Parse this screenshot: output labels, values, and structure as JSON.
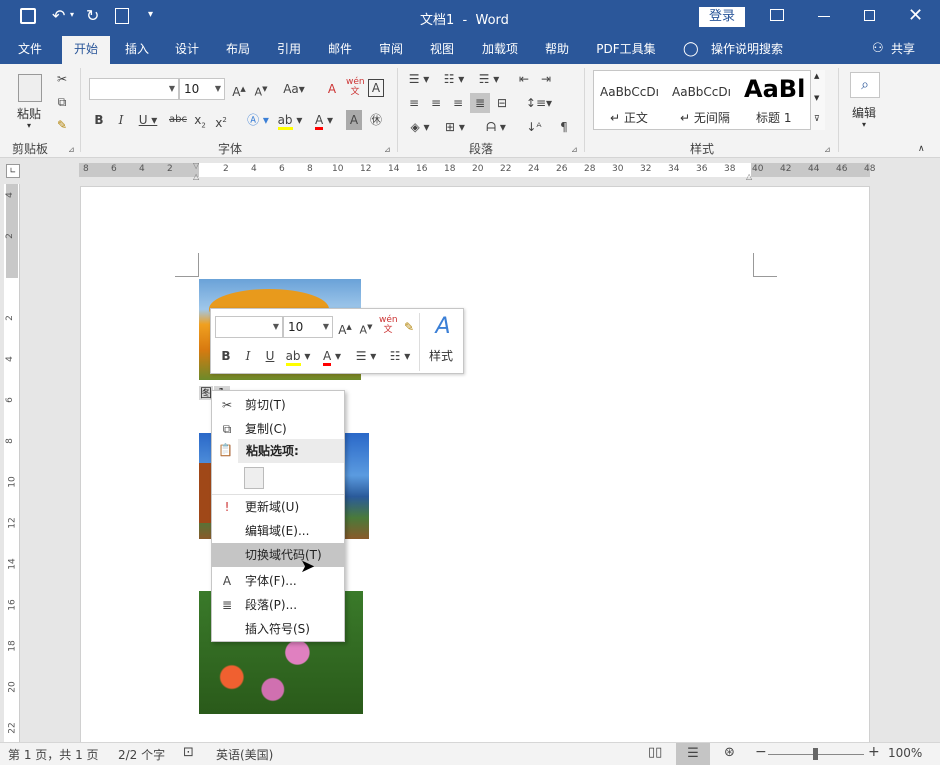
{
  "titlebar": {
    "doc_title": "文档1  -  Word",
    "login_label": "登录",
    "quick_access": [
      "save-icon",
      "undo-icon",
      "redo-icon",
      "touch-mode-icon",
      "customize-icon"
    ],
    "window_controls": [
      "ribbon-display-icon",
      "minimize-icon",
      "maximize-icon",
      "close-icon"
    ]
  },
  "tabs": [
    {
      "label": "文件"
    },
    {
      "label": "开始"
    },
    {
      "label": "插入"
    },
    {
      "label": "设计"
    },
    {
      "label": "布局"
    },
    {
      "label": "引用"
    },
    {
      "label": "邮件"
    },
    {
      "label": "审阅"
    },
    {
      "label": "视图"
    },
    {
      "label": "加载项"
    },
    {
      "label": "帮助"
    },
    {
      "label": "PDF工具集"
    }
  ],
  "tell_me": "操作说明搜索",
  "share": "共享",
  "ribbon": {
    "clipboard": {
      "label": "剪贴板",
      "paste": "粘贴"
    },
    "font": {
      "label": "字体",
      "font_name": "",
      "font_size": "10"
    },
    "paragraph": {
      "label": "段落"
    },
    "styles": {
      "label": "样式",
      "items": [
        {
          "preview": "AaBbCcDı",
          "name": "↵ 正文"
        },
        {
          "preview": "AaBbCcDı",
          "name": "↵ 无间隔"
        },
        {
          "preview": "AaBl",
          "name": "标题 1"
        }
      ]
    },
    "editing": {
      "label": "编辑"
    }
  },
  "ruler_h": [
    "8",
    "6",
    "4",
    "2",
    "",
    "2",
    "4",
    "6",
    "8",
    "10",
    "12",
    "14",
    "16",
    "18",
    "20",
    "22",
    "24",
    "26",
    "28",
    "30",
    "32",
    "34",
    "36",
    "38",
    "40",
    "42",
    "44",
    "46",
    "48"
  ],
  "ruler_v": [
    "4",
    "2",
    "",
    "2",
    "4",
    "6",
    "8",
    "10",
    "12",
    "14",
    "16",
    "18",
    "20",
    "22"
  ],
  "caption_label": "图",
  "mini_toolbar": {
    "font_name": "",
    "font_size": "10",
    "styles_label": "样式"
  },
  "context_menu": [
    {
      "label": "剪切(T)",
      "icon": "scissors-icon"
    },
    {
      "label": "复制(C)",
      "icon": "copy-icon"
    },
    {
      "label": "粘贴选项:",
      "icon": "paste-icon"
    },
    {
      "label": "更新域(U)",
      "icon": "update-field-icon"
    },
    {
      "label": "编辑域(E)...",
      "icon": ""
    },
    {
      "label": "切换域代码(T)",
      "icon": ""
    },
    {
      "label": "字体(F)...",
      "icon": "font-icon"
    },
    {
      "label": "段落(P)...",
      "icon": "paragraph-icon"
    },
    {
      "label": "插入符号(S)",
      "icon": ""
    }
  ],
  "statusbar": {
    "page": "第 1 页，共 1 页",
    "words": "2/2 个字",
    "language": "英语(美国)",
    "zoom": "100%"
  },
  "colors": {
    "accent": "#2b579a",
    "ribbon_bg": "#f3f3f3",
    "highlight": "#ffff00",
    "font_color": "#ff0000"
  }
}
